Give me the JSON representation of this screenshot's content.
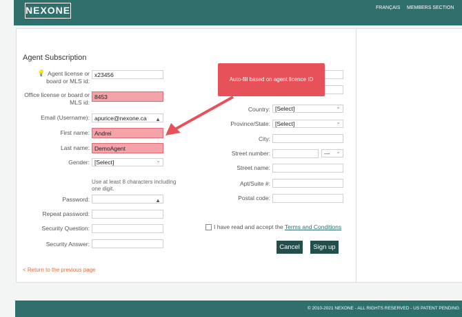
{
  "header": {
    "logo": "NEXONE",
    "nav": [
      "FRANÇAIS",
      "MEMBERS SECTION"
    ]
  },
  "form": {
    "title": "Agent Subscription",
    "agent_license_label": "Agent license or board or MLS id:",
    "agent_license_value": "x23456",
    "office_license_label": "Office license or board or MLS id:",
    "office_license_value": "8453",
    "email_label": "Email (Username):",
    "email_value": "apurice@nexone.ca",
    "first_name_label": "First name:",
    "first_name_value": "Andrei",
    "last_name_label": "Last name:",
    "last_name_value": "DemoAgent",
    "gender_label": "Gender:",
    "gender_value": "[Select]",
    "password_hint": "Use at least 8 characters including one digit.",
    "password_label": "Password:",
    "repeat_password_label": "Repeat password:",
    "security_question_label": "Security Question:",
    "security_answer_label": "Security Answer:",
    "country_label": "Country:",
    "country_value": "[Select]",
    "province_label": "Province/State:",
    "province_value": "[Select]",
    "city_label": "City:",
    "street_number_label": "Street number:",
    "street_number_select": "---",
    "street_name_label": "Street name:",
    "apt_label": "Apt/Suite #:",
    "postal_label": "Postal code:",
    "terms_prefix": "I have read and accept the",
    "terms_link": "Terms and Conditions",
    "cancel_label": "Cancel",
    "signup_label": "Sign up",
    "return_link": "< Return to the previous page"
  },
  "annotation": {
    "callout_text": "Auto-fill based on agent licence ID"
  },
  "footer": {
    "text": "© 2010-2021 NEXONE - ALL RIGHTS RESERVED - US PATENT PENDING"
  }
}
